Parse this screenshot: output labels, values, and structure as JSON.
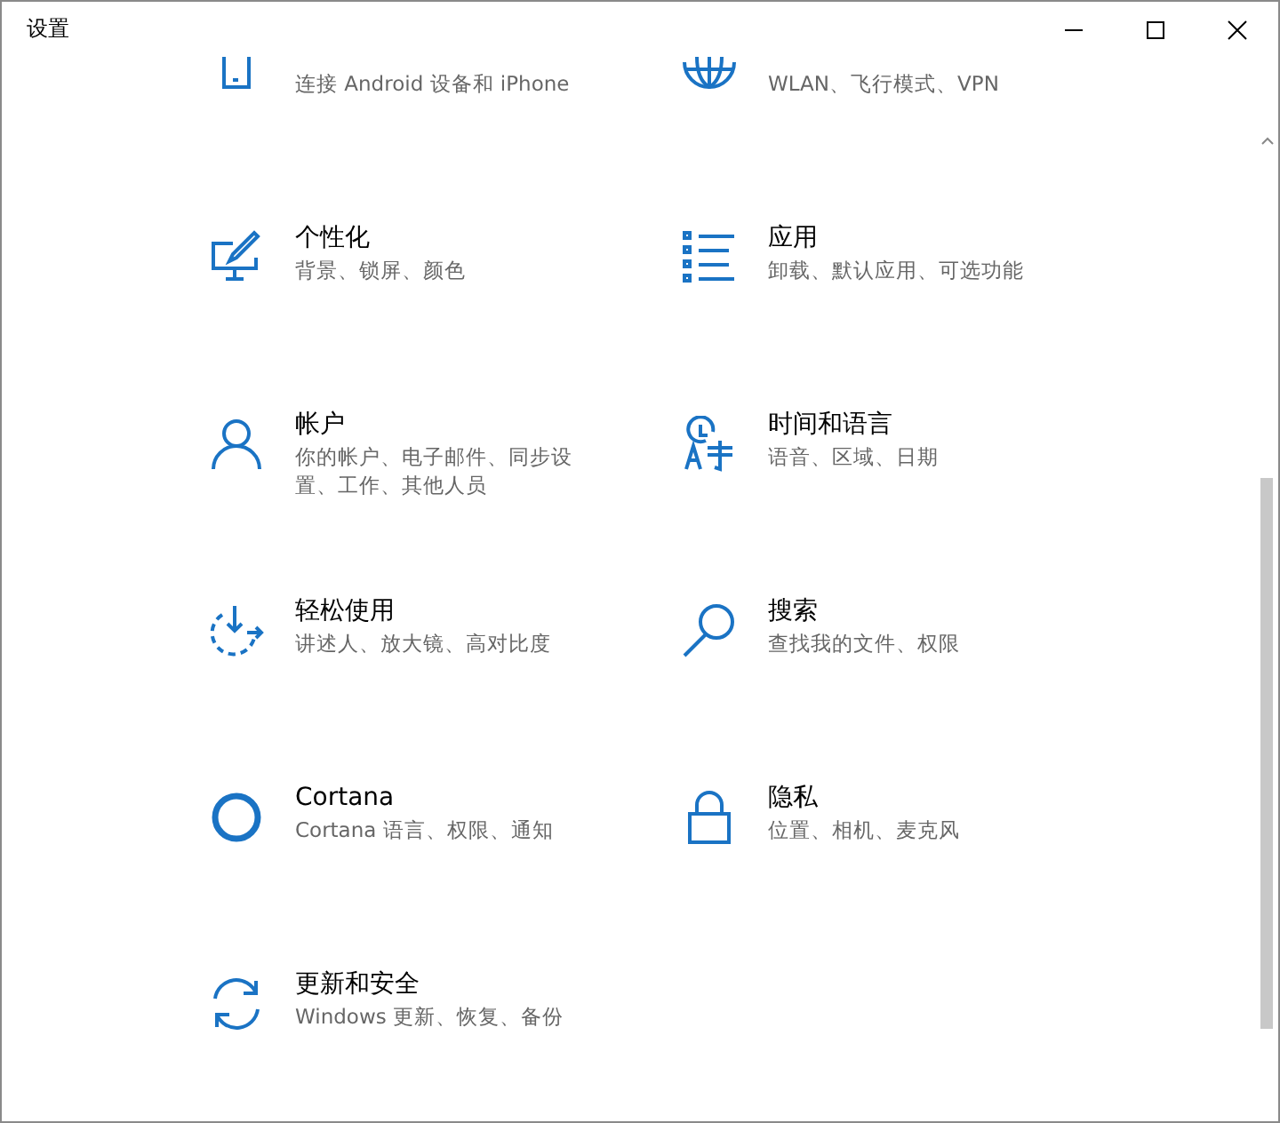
{
  "window": {
    "title": "设置"
  },
  "categories": [
    {
      "description": "连接 Android 设备和 iPhone"
    },
    {
      "description": "WLAN、飞行模式、VPN"
    },
    {
      "title": "个性化",
      "description": "背景、锁屏、颜色"
    },
    {
      "title": "应用",
      "description": "卸载、默认应用、可选功能"
    },
    {
      "title": "帐户",
      "description": "你的帐户、电子邮件、同步设置、工作、其他人员"
    },
    {
      "title": "时间和语言",
      "description": "语音、区域、日期"
    },
    {
      "title": "轻松使用",
      "description": "讲述人、放大镜、高对比度"
    },
    {
      "title": "搜索",
      "description": "查找我的文件、权限"
    },
    {
      "title": "Cortana",
      "description": "Cortana 语言、权限、通知"
    },
    {
      "title": "隐私",
      "description": "位置、相机、麦克风"
    },
    {
      "title": "更新和安全",
      "description": "Windows 更新、恢复、备份"
    }
  ]
}
